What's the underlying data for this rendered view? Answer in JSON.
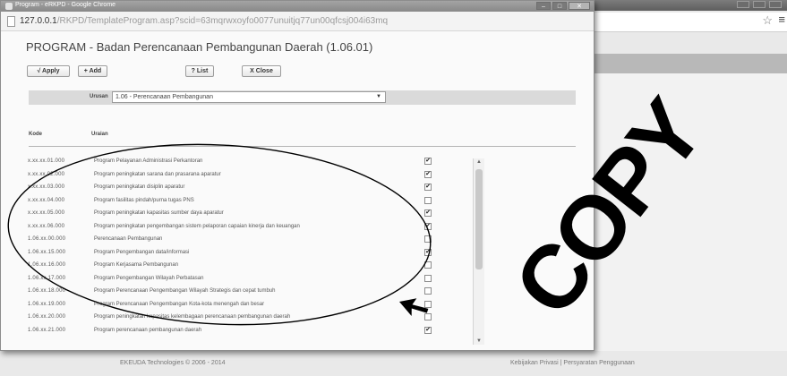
{
  "popup": {
    "window_title": "Program - eRKPD - Google Chrome",
    "url_host": "127.0.0.1",
    "url_path": "/RKPD/TemplateProgram.asp?scid=63mqrwxoyfo0077unuitjq77un00qfcsj004i63mq",
    "page_title": "PROGRAM - Badan Perencanaan Pembangunan Daerah (1.06.01)",
    "buttons": {
      "apply": "√ Apply",
      "add": "+ Add",
      "list": "? List",
      "close": "X Close"
    },
    "urusan": {
      "label": "Urusan",
      "selected": "1.06 - Perencanaan Pembangunan"
    },
    "table": {
      "headers": {
        "kode": "Kode",
        "uraian": "Uraian"
      },
      "rows": [
        {
          "kode": "x.xx.xx.01.000",
          "uraian": "Program Pelayanan Administrasi Perkantoran",
          "checked": true
        },
        {
          "kode": "x.xx.xx.02.000",
          "uraian": "Program peningkatan sarana dan prasarana aparatur",
          "checked": true
        },
        {
          "kode": "x.xx.xx.03.000",
          "uraian": "Program peningkatan disiplin aparatur",
          "checked": true
        },
        {
          "kode": "x.xx.xx.04.000",
          "uraian": "Program fasilitas pindah/purna tugas PNS",
          "checked": false
        },
        {
          "kode": "x.xx.xx.05.000",
          "uraian": "Program peningkatan kapasitas sumber daya aparatur",
          "checked": true
        },
        {
          "kode": "x.xx.xx.06.000",
          "uraian": "Program peningkatan pengembangan sistem pelaporan capaian kinerja dan keuangan",
          "checked": true
        },
        {
          "kode": "1.06.xx.00.000",
          "uraian": "Perencanaan Pembangunan",
          "checked": false
        },
        {
          "kode": "1.06.xx.15.000",
          "uraian": "Program Pengembangan data/informasi",
          "checked": true
        },
        {
          "kode": "1.06.xx.16.000",
          "uraian": "Program Kerjasama Pembangunan",
          "checked": false
        },
        {
          "kode": "1.06.xx.17.000",
          "uraian": "Program Pengembangan Wilayah Perbatasan",
          "checked": false
        },
        {
          "kode": "1.06.xx.18.000",
          "uraian": "Program Perencanaan Pengembangan Wilayah Strategis dan cepat tumbuh",
          "checked": false
        },
        {
          "kode": "1.06.xx.19.000",
          "uraian": "Program Perencanaan Pengembangan Kota-kota menengah dan besar",
          "checked": false
        },
        {
          "kode": "1.06.xx.20.000",
          "uraian": "Program peningkatan kapasitas kelembagaan perencanaan pembangunan daerah",
          "checked": false
        },
        {
          "kode": "1.06.xx.21.000",
          "uraian": "Program perencanaan pembangunan daerah",
          "checked": true
        }
      ]
    }
  },
  "footer": {
    "left": "EKEUDA Technologies © 2006 - 2014",
    "right": "Kebijakan Privasi | Persyaratan Penggunaan"
  },
  "watermark": "COPY",
  "icons": {
    "window_close": "close-icon",
    "star": "star-icon",
    "menu": "menu-icon",
    "pointer": "arrow-pointer-icon"
  },
  "colors": {
    "annotation": "#000000",
    "titlebar": "#8e8e8e"
  }
}
